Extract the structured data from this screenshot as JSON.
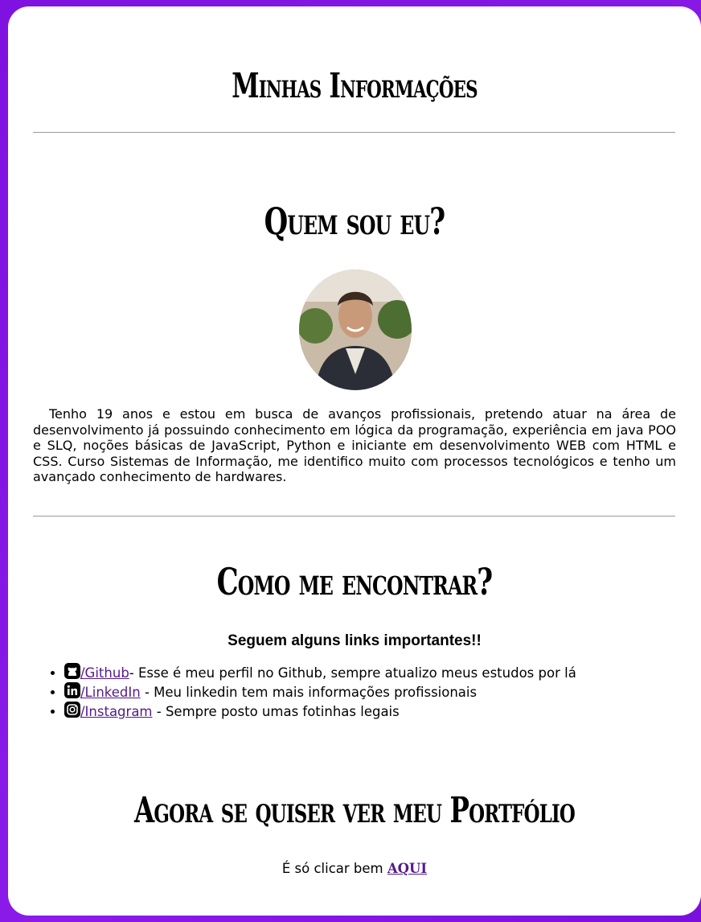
{
  "header": {
    "title": "Minhas Informações"
  },
  "about": {
    "title": "Quem sou eu?",
    "bio": "Tenho 19 anos e estou em busca de avanços profissionais, pretendo atuar na área de desenvolvimento já possuindo conhecimento em lógica da programação, experiência em java POO e SLQ, noções básicas de JavaScript, Python e iniciante em desenvolvimento WEB com HTML e CSS. Curso Sistemas de Informação, me identifico muito com processos tecnológicos e tenho um avançado conhecimento de hardwares."
  },
  "contact": {
    "title": "Como me encontrar?",
    "subtitle": "Seguem alguns links importantes!!",
    "links": [
      {
        "icon": "github-icon",
        "label": "/Github",
        "description": "- Esse é meu perfil no Github, sempre atualizo meus estudos por lá"
      },
      {
        "icon": "linkedin-icon",
        "label": "/LinkedIn",
        "description": " - Meu linkedin tem mais informações profissionais"
      },
      {
        "icon": "instagram-icon",
        "label": "/Instagram",
        "description": " - Sempre posto umas fotinhas legais"
      }
    ]
  },
  "portfolio": {
    "title": "Agora se quiser ver meu Portfólio",
    "text": "É só clicar bem ",
    "link_label": "AQUI"
  },
  "colors": {
    "background": "#8a1be8",
    "link": "#551a8b",
    "card": "#ffffff"
  }
}
